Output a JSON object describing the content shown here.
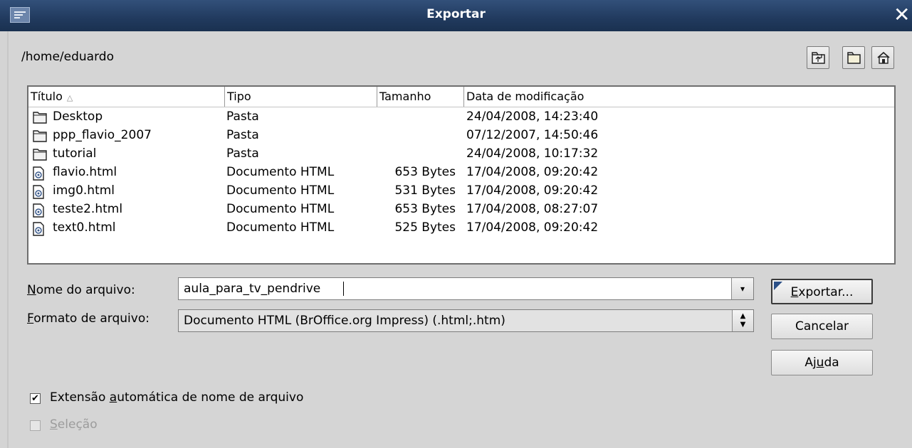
{
  "window": {
    "title": "Exportar",
    "close_glyph": "✕"
  },
  "path": "/home/eduardo",
  "toolbar": [
    {
      "icon": "folder-up-icon"
    },
    {
      "icon": "new-folder-icon"
    },
    {
      "icon": "home-icon"
    }
  ],
  "columns": [
    {
      "label": "Título",
      "sort": "△"
    },
    {
      "label": "Tipo"
    },
    {
      "label": "Tamanho"
    },
    {
      "label": "Data de modificação"
    }
  ],
  "files": [
    {
      "name": "Desktop",
      "type": "Pasta",
      "size": "",
      "date": "24/04/2008, 14:23:40",
      "icon": "folder-icon"
    },
    {
      "name": "ppp_flavio_2007",
      "type": "Pasta",
      "size": "",
      "date": "07/12/2007, 14:50:46",
      "icon": "folder-icon"
    },
    {
      "name": "tutorial",
      "type": "Pasta",
      "size": "",
      "date": "24/04/2008, 10:17:32",
      "icon": "folder-icon"
    },
    {
      "name": "flavio.html",
      "type": "Documento HTML",
      "size": "653 Bytes",
      "date": "17/04/2008, 09:20:42",
      "icon": "html-file-icon"
    },
    {
      "name": "img0.html",
      "type": "Documento HTML",
      "size": "531 Bytes",
      "date": "17/04/2008, 09:20:42",
      "icon": "html-file-icon"
    },
    {
      "name": "teste2.html",
      "type": "Documento HTML",
      "size": "653 Bytes",
      "date": "17/04/2008, 08:27:07",
      "icon": "html-file-icon"
    },
    {
      "name": "text0.html",
      "type": "Documento HTML",
      "size": "525 Bytes",
      "date": "17/04/2008, 09:20:42",
      "icon": "html-file-icon"
    }
  ],
  "filename": {
    "label_u": "N",
    "label_rest": "ome do arquivo:",
    "value": "aula_para_tv_pendrive"
  },
  "format": {
    "label_u": "F",
    "label_rest": "ormato de arquivo:",
    "value": "Documento HTML (BrOffice.org Impress) (.html;.htm)"
  },
  "buttons": {
    "export": {
      "u": "E",
      "rest": "xportar..."
    },
    "cancel": {
      "label": "Cancelar"
    },
    "help": {
      "pre": "Aj",
      "u": "u",
      "rest": "da"
    }
  },
  "auto_ext": {
    "checked": true,
    "pre": "Extensão ",
    "u": "a",
    "rest": "utomática de nome de arquivo"
  },
  "selection": {
    "checked": false,
    "u": "S",
    "rest": "eleção"
  },
  "colors": {
    "titlebar": "#213a5e",
    "accent": "#2b4f86"
  }
}
